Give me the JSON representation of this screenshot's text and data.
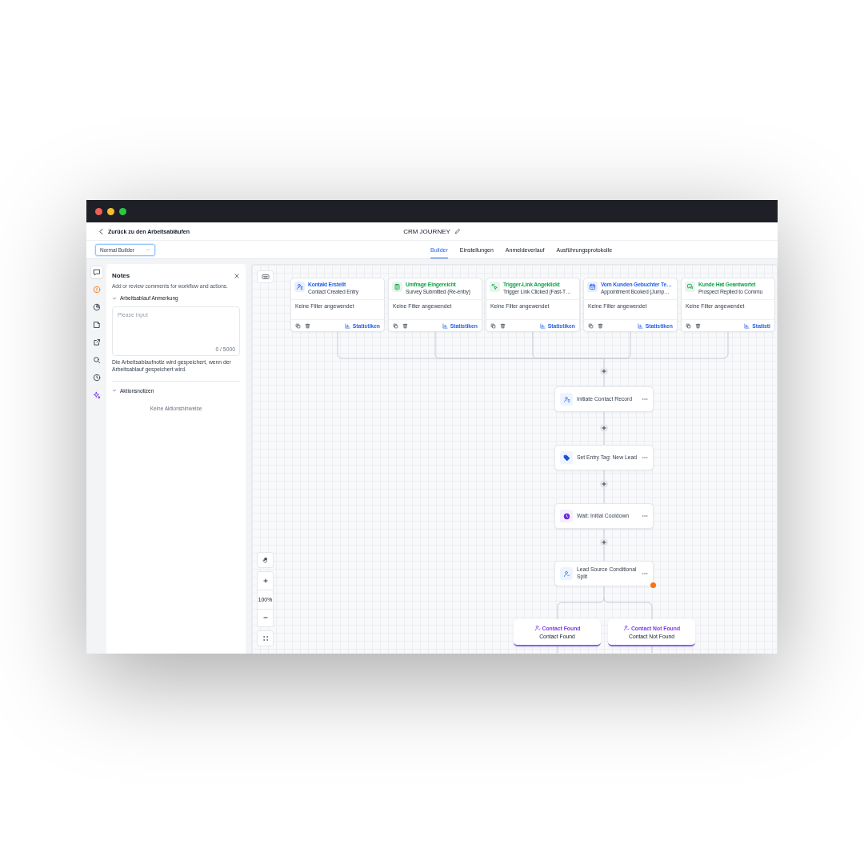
{
  "header": {
    "back_link": "Zurück zu den Arbeitsabläufen",
    "title": "CRM JOURNEY"
  },
  "builder_select": {
    "value": "Normal Builder"
  },
  "tabs": [
    {
      "label": "Builder",
      "selected": true
    },
    {
      "label": "Einstellungen",
      "selected": false
    },
    {
      "label": "Anmeldeverlauf",
      "selected": false
    },
    {
      "label": "Ausführungsprotokolle",
      "selected": false
    }
  ],
  "rail": {
    "items": [
      {
        "kind": "comment",
        "selected": true
      },
      {
        "kind": "alert",
        "selected": false
      },
      {
        "kind": "history",
        "selected": false
      },
      {
        "kind": "note",
        "selected": false
      },
      {
        "kind": "export",
        "selected": false
      },
      {
        "kind": "search",
        "selected": false
      },
      {
        "kind": "clock",
        "selected": false
      },
      {
        "kind": "ai",
        "selected": false
      }
    ]
  },
  "notes_panel": {
    "title": "Notes",
    "subtitle": "Add or review comments for workflow and actions.",
    "workflow_note": {
      "heading": "Arbeitsablauf Anmerkung",
      "expanded": true,
      "placeholder": "Please Input",
      "counter": "0 / 5000",
      "hint": "Die Arbeitsablaufnotiz wird gespeichert, wenn der Arbeitsablauf gespeichert wird."
    },
    "action_notes": {
      "heading": "Aktionsnotizen",
      "expanded": true,
      "empty": "Keine Aktionshinweise"
    }
  },
  "canvas": {
    "triggers": [
      {
        "kind": "contact",
        "title": "Kontakt Erstellt",
        "subtitle": "Contact Created Entry",
        "filter": "Keine Filter angewendet",
        "stats": "Statistiken",
        "color": "#2563eb"
      },
      {
        "kind": "survey",
        "title": "Umfrage Eingereicht",
        "subtitle": "Survey Submitted (Re-entry)",
        "filter": "Keine Filter angewendet",
        "stats": "Statistiken",
        "color": "#16a34a"
      },
      {
        "kind": "click",
        "title": "Trigger-Link Angeklickt",
        "subtitle": "Trigger Link Clicked (Fast-T…",
        "filter": "Keine Filter angewendet",
        "stats": "Statistiken",
        "color": "#16a34a"
      },
      {
        "kind": "calendar",
        "title": "Vom Kunden Gebuchter Te…",
        "subtitle": "Appointment Booked (Jump…",
        "filter": "Keine Filter angewendet",
        "stats": "Statistiken",
        "color": "#2563eb"
      },
      {
        "kind": "chat",
        "title": "Kunde Hat Geantwortet",
        "subtitle": "Prospect Replied to Commu",
        "filter": "Keine Filter angewendet",
        "stats": "Statisti",
        "color": "#16a34a"
      }
    ],
    "actions": [
      {
        "kind": "contact",
        "label": "Initiate Contact Record",
        "warning": false
      },
      {
        "kind": "tag",
        "label": "Set Entry Tag: New Lead",
        "warning": false
      },
      {
        "kind": "wait",
        "label": "Wait: Initial Cooldown",
        "warning": false
      },
      {
        "kind": "split",
        "label": "Lead Source Conditional Split",
        "warning": true
      }
    ],
    "branches": [
      {
        "title": "Contact Found",
        "subtitle": "Contact Found"
      },
      {
        "title": "Contact Not Found",
        "subtitle": "Contact Not Found"
      }
    ],
    "zoom_level": "100%"
  }
}
